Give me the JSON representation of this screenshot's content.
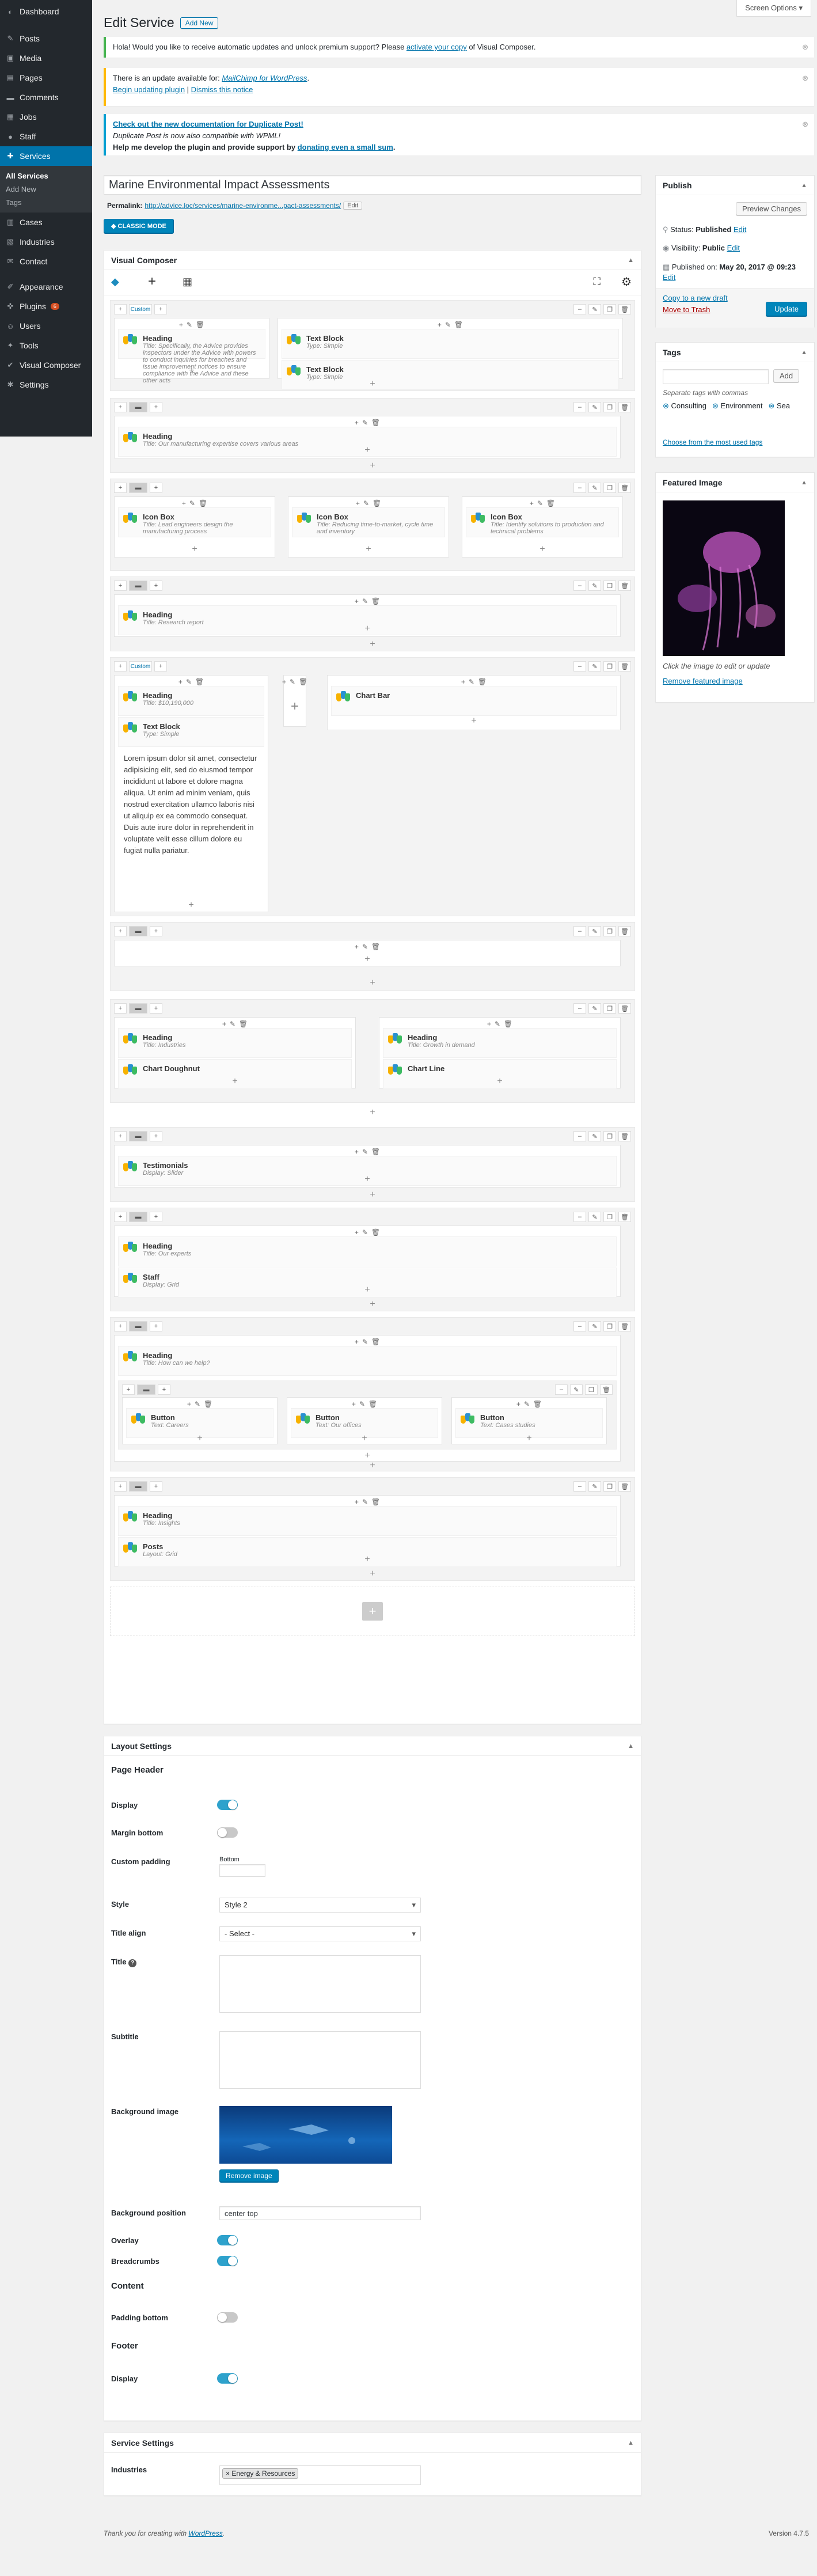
{
  "menu": {
    "items": [
      {
        "label": "Dashboard",
        "icon": "dashboard-icon",
        "glyph": "◐"
      },
      {
        "label": "Posts",
        "icon": "pin-icon",
        "glyph": "✎"
      },
      {
        "label": "Media",
        "icon": "media-icon",
        "glyph": "▣"
      },
      {
        "label": "Pages",
        "icon": "page-icon",
        "glyph": "▤"
      },
      {
        "label": "Comments",
        "icon": "comment-icon",
        "glyph": "▬"
      },
      {
        "label": "Jobs",
        "icon": "briefcase-icon",
        "glyph": "▦"
      },
      {
        "label": "Staff",
        "icon": "users-icon",
        "glyph": "●"
      }
    ],
    "current": {
      "label": "Services",
      "icon": "services-icon",
      "glyph": "✚"
    },
    "sub": [
      "All Services",
      "Add New",
      "Tags"
    ],
    "items2": [
      {
        "label": "Cases",
        "icon": "folder-icon",
        "glyph": "▥"
      },
      {
        "label": "Industries",
        "icon": "building-icon",
        "glyph": "▧"
      },
      {
        "label": "Contact",
        "icon": "mail-icon",
        "glyph": "✉"
      }
    ],
    "items3": [
      {
        "label": "Appearance",
        "icon": "brush-icon",
        "glyph": "✐"
      },
      {
        "label": "Plugins",
        "icon": "plugin-icon",
        "glyph": "✜",
        "badge": "6"
      },
      {
        "label": "Users",
        "icon": "user-icon",
        "glyph": "☺"
      },
      {
        "label": "Tools",
        "icon": "wrench-icon",
        "glyph": "✦"
      },
      {
        "label": "Visual Composer",
        "icon": "vc-icon",
        "glyph": "✔"
      },
      {
        "label": "Settings",
        "icon": "settings-icon",
        "glyph": "✱"
      }
    ]
  },
  "header": {
    "title": "Edit Service",
    "add_new": "Add New",
    "screen_options": "Screen Options ▾"
  },
  "notices": {
    "vc_pre": "Hola! Would you like to receive automatic updates and unlock premium support? Please ",
    "vc_link": "activate your copy",
    "vc_post": " of Visual Composer.",
    "mc_pre": "There is an update available for: ",
    "mc_link": "MailChimp for WordPress",
    "mc_begin": "Begin updating plugin",
    "mc_dismiss": "Dismiss this notice",
    "dp_l1": "Check out the new documentation for Duplicate Post!",
    "dp_l2": "Duplicate Post is now also compatible with WPML!",
    "dp_l3_pre": "Help me develop the plugin and provide support by ",
    "dp_l3_link": "donating even a small sum"
  },
  "post": {
    "title": "Marine Environmental Impact Assessments",
    "permalink_label": "Permalink:",
    "permalink": "http://advice.loc/services/marine-environme...pact-assessments/",
    "edit": "Edit",
    "classic_mode": "CLASSIC MODE"
  },
  "vc": {
    "title": "Visual Composer",
    "custom": "Custom",
    "rows": {
      "r1": [
        {
          "title": "Heading",
          "sub": "Title: Specifically, the Advice provides inspectors under the Advice with powers to conduct inquiries for breaches and issue improvement notices to ensure compliance with the Advice and these other acts"
        },
        {
          "title": "Text Block",
          "sub": "Type: Simple"
        },
        {
          "title": "Text Block",
          "sub": "Type: Simple"
        }
      ],
      "r2": {
        "title": "Heading",
        "sub": "Title: Our manufacturing expertise covers various areas"
      },
      "r3": [
        {
          "title": "Icon Box",
          "sub": "Title: Lead engineers design the manufacturing process"
        },
        {
          "title": "Icon Box",
          "sub": "Title: Reducing time-to-market, cycle time and inventory"
        },
        {
          "title": "Icon Box",
          "sub": "Title: Identify solutions to production and technical problems"
        }
      ],
      "r4": {
        "title": "Heading",
        "sub": "Title: Research report"
      },
      "r5": [
        {
          "title": "Heading",
          "sub": "Title: $10,190,000"
        },
        {
          "title": "Text Block",
          "sub": "Type: Simple"
        },
        {
          "title": "Chart Bar",
          "sub": ""
        }
      ],
      "lorem": "Lorem ipsum dolor sit amet, consectetur adipisicing elit, sed do eiusmod tempor incididunt ut labore et dolore magna aliqua. Ut enim ad minim veniam, quis nostrud exercitation ullamco laboris nisi ut aliquip ex ea commodo consequat. Duis aute irure dolor in reprehenderit in voluptate velit esse cillum dolore eu fugiat nulla pariatur.",
      "r7": [
        {
          "title": "Heading",
          "sub": "Title: Industries"
        },
        {
          "title": "Chart Doughnut",
          "sub": ""
        },
        {
          "title": "Heading",
          "sub": "Title: Growth in demand"
        },
        {
          "title": "Chart Line",
          "sub": ""
        }
      ],
      "r8": {
        "title": "Testimonials",
        "sub": "Display: Slider"
      },
      "r9": [
        {
          "title": "Heading",
          "sub": "Title: Our experts"
        },
        {
          "title": "Staff",
          "sub": "Display: Grid"
        }
      ],
      "r10": {
        "title": "Heading",
        "sub": "Title: How can we help?"
      },
      "r10b": [
        {
          "title": "Button",
          "sub": "Text: Careers"
        },
        {
          "title": "Button",
          "sub": "Text: Our offices"
        },
        {
          "title": "Button",
          "sub": "Text: Cases studies"
        }
      ],
      "r11": [
        {
          "title": "Heading",
          "sub": "Title: Insights"
        },
        {
          "title": "Posts",
          "sub": "Layout: Grid"
        }
      ]
    }
  },
  "publish": {
    "title": "Publish",
    "preview": "Preview Changes",
    "status": "Status: ",
    "status_val": "Published",
    "edit": "Edit",
    "visibility": "Visibility: ",
    "visibility_val": "Public",
    "published_on": "Published on: ",
    "published_date": "May 20, 2017 @ 09:23",
    "copy_draft": "Copy to a new draft",
    "trash": "Move to Trash",
    "update": "Update"
  },
  "tags": {
    "title": "Tags",
    "add": "Add",
    "hint": "Separate tags with commas",
    "list": [
      "Consulting",
      "Environment",
      "Sea"
    ],
    "choose": "Choose from the most used tags"
  },
  "featured": {
    "title": "Featured Image",
    "hint": "Click the image to edit or update",
    "remove": "Remove featured image"
  },
  "layout": {
    "title": "Layout Settings",
    "page_header": "Page Header",
    "display": "Display",
    "margin_bottom": "Margin bottom",
    "custom_padding": "Custom padding",
    "bottom": "Bottom",
    "style": "Style",
    "style_val": "Style 2",
    "title_align": "Title align",
    "title_align_val": "- Select -",
    "title_field": "Title",
    "subtitle": "Subtitle",
    "bg_image": "Background image",
    "remove_image": "Remove image",
    "bg_position": "Background position",
    "bg_position_val": "center top",
    "overlay": "Overlay",
    "breadcrumbs": "Breadcrumbs",
    "content": "Content",
    "padding_bottom": "Padding bottom",
    "footer": "Footer",
    "footer_display": "Display"
  },
  "service_settings": {
    "title": "Service Settings",
    "industries": "Industries",
    "industry_tag": "× Energy & Resources"
  },
  "footer": {
    "pre": "Thank you for creating with ",
    "link": "WordPress",
    "post": ".",
    "version": "Version 4.7.5"
  },
  "colors": {
    "primary": "#0073aa",
    "menu_bg": "#23282d",
    "toggle_on": "#2ea2cc"
  }
}
